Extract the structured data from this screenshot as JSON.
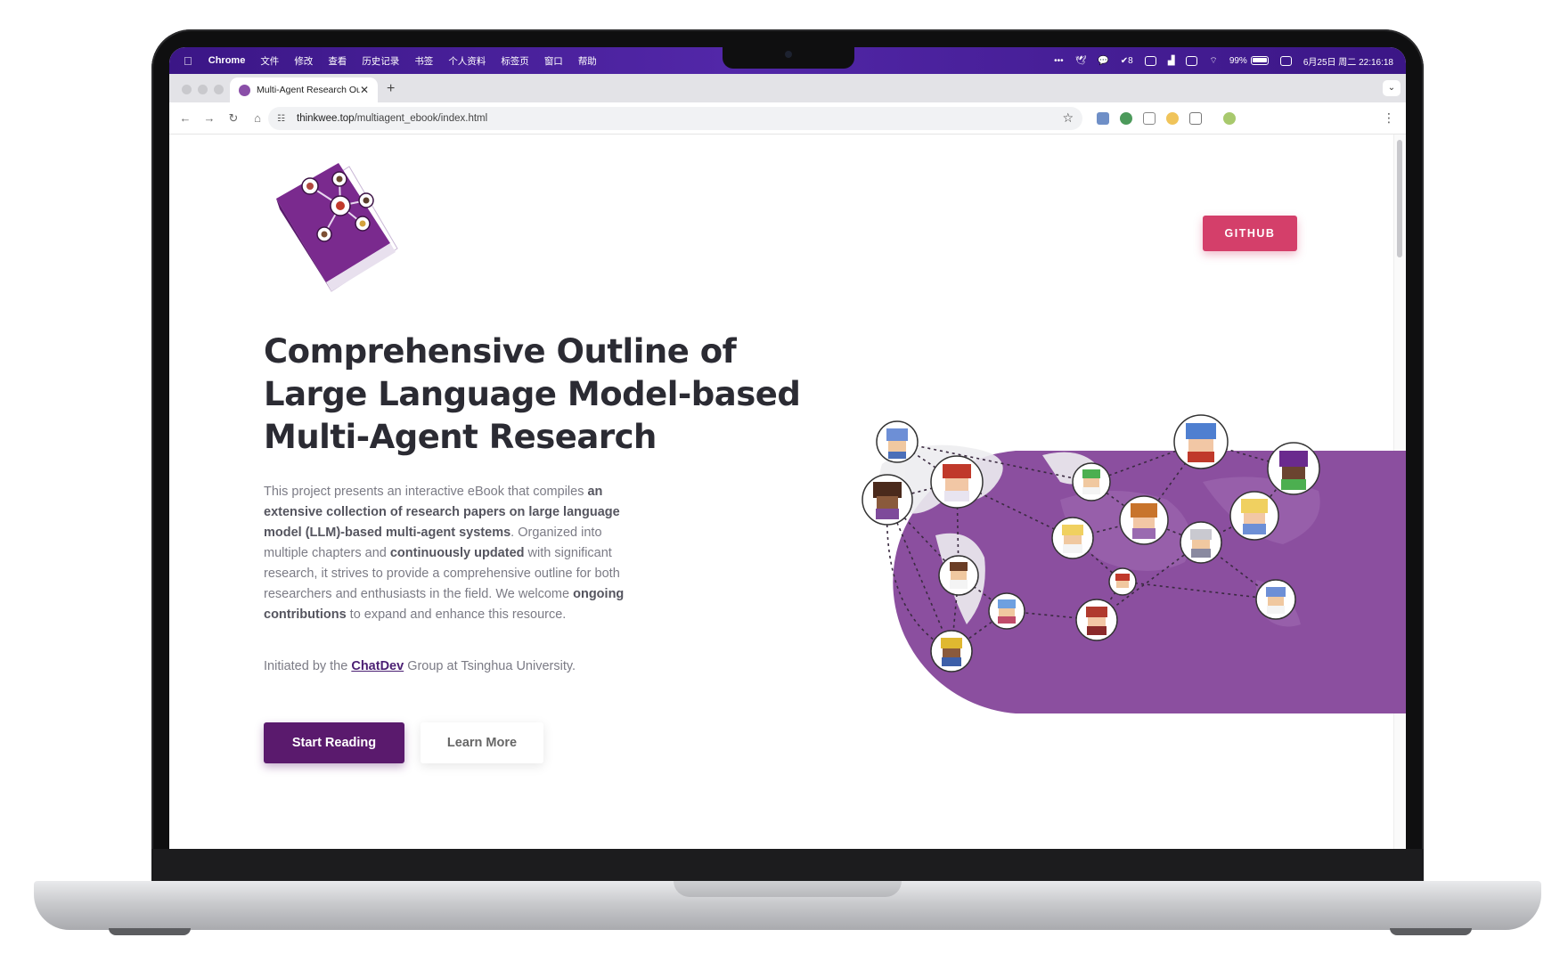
{
  "menubar": {
    "app": "Chrome",
    "items": [
      "文件",
      "修改",
      "查看",
      "历史记录",
      "书签",
      "个人资料",
      "标签页",
      "窗口",
      "帮助"
    ],
    "battery": "99%",
    "reminders_count": "8",
    "datetime": "6月25日 周二 22:16:18"
  },
  "browser": {
    "tab_title": "Multi-Agent Research Outline",
    "url_host": "thinkwee.top",
    "url_path": "/multiagent_ebook/index.html"
  },
  "page": {
    "github_label": "GITHUB",
    "headline_line1": "Comprehensive Outline of",
    "headline_line2": "Large Language Model-based",
    "headline_line3": "Multi-Agent Research",
    "desc": {
      "p1": "This project presents an interactive eBook that compiles ",
      "b1": "an extensive collection of research papers on large language model (LLM)-based multi-agent systems",
      "p2": ". Organized into multiple chapters and ",
      "b2": "continuously updated",
      "p3": " with significant research, it strives to provide a comprehensive outline for both researchers and enthusiasts in the field. We welcome ",
      "b3": "ongoing contributions",
      "p4": " to expand and enhance this resource."
    },
    "initiated_prefix": "Initiated by the ",
    "initiated_link": "ChatDev",
    "initiated_suffix": " Group at Tsinghua University.",
    "start_label": "Start Reading",
    "learn_label": "Learn More"
  },
  "colors": {
    "brand_purple": "#5a1a6d",
    "github_pink": "#d43f6a",
    "blob_purple": "#8b4f9f",
    "menubar_purple": "#4a1f9a"
  }
}
